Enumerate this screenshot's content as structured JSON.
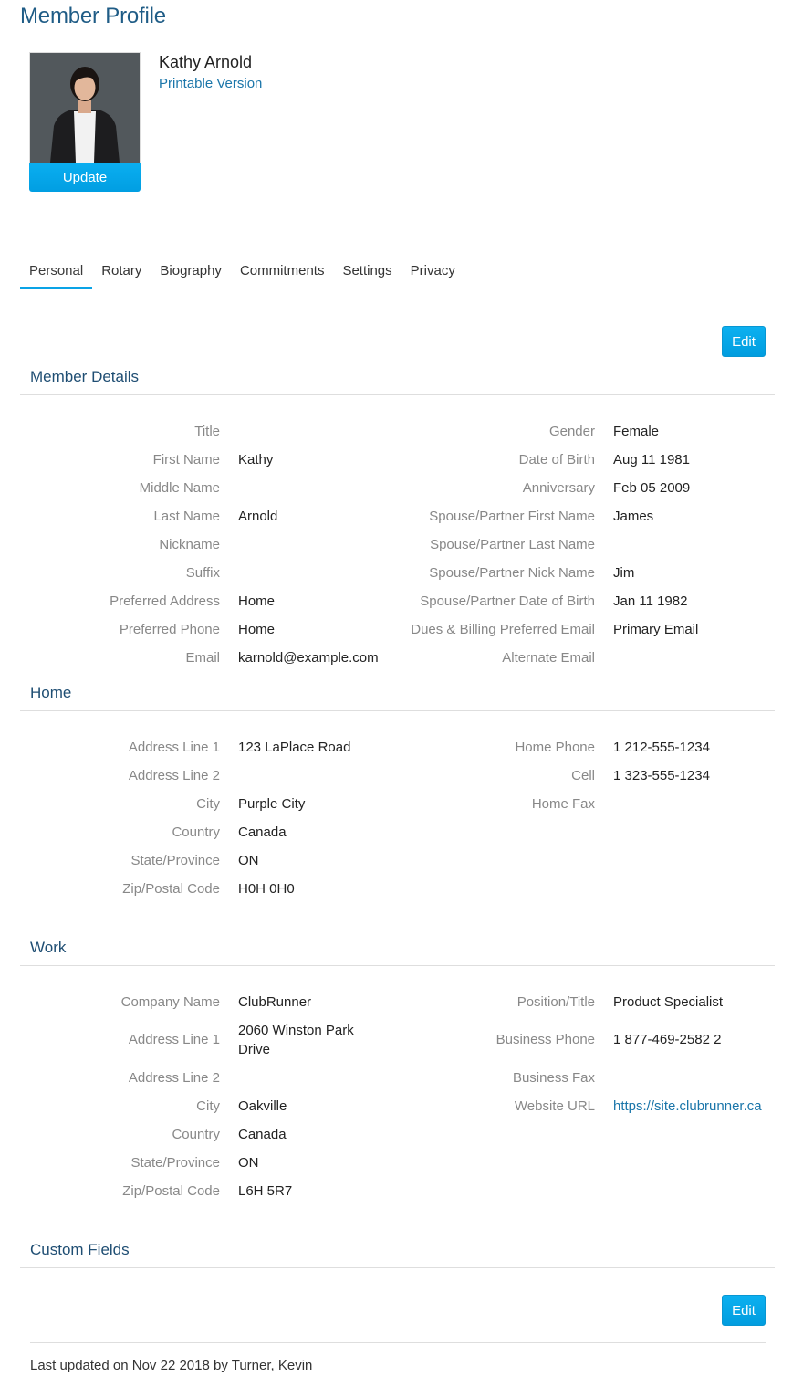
{
  "page": {
    "title": "Member Profile"
  },
  "profile": {
    "name": "Kathy Arnold",
    "printable_link": "Printable Version",
    "update_label": "Update"
  },
  "tabs": [
    {
      "label": "Personal",
      "active": true
    },
    {
      "label": "Rotary",
      "active": false
    },
    {
      "label": "Biography",
      "active": false
    },
    {
      "label": "Commitments",
      "active": false
    },
    {
      "label": "Settings",
      "active": false
    },
    {
      "label": "Privacy",
      "active": false
    }
  ],
  "edit_label": "Edit",
  "member_details": {
    "title": "Member Details",
    "left": [
      {
        "label": "Title",
        "value": ""
      },
      {
        "label": "First Name",
        "value": "Kathy"
      },
      {
        "label": "Middle Name",
        "value": ""
      },
      {
        "label": "Last Name",
        "value": "Arnold"
      },
      {
        "label": "Nickname",
        "value": ""
      },
      {
        "label": "Suffix",
        "value": ""
      },
      {
        "label": "Preferred Address",
        "value": "Home"
      },
      {
        "label": "Preferred Phone",
        "value": "Home"
      },
      {
        "label": "Email",
        "value": "karnold@example.com"
      }
    ],
    "right": [
      {
        "label": "Gender",
        "value": "Female"
      },
      {
        "label": "Date of Birth",
        "value": "Aug 11 1981"
      },
      {
        "label": "Anniversary",
        "value": "Feb 05 2009"
      },
      {
        "label": "Spouse/Partner First Name",
        "value": "James"
      },
      {
        "label": "Spouse/Partner Last Name",
        "value": ""
      },
      {
        "label": "Spouse/Partner Nick Name",
        "value": "Jim"
      },
      {
        "label": "Spouse/Partner Date of Birth",
        "value": "Jan 11 1982"
      },
      {
        "label": "Dues & Billing Preferred Email",
        "value": "Primary Email"
      },
      {
        "label": "Alternate Email",
        "value": ""
      }
    ]
  },
  "home": {
    "title": "Home",
    "left": [
      {
        "label": "Address Line 1",
        "value": "123 LaPlace Road"
      },
      {
        "label": "Address Line 2",
        "value": ""
      },
      {
        "label": "City",
        "value": "Purple City"
      },
      {
        "label": "Country",
        "value": "Canada"
      },
      {
        "label": "State/Province",
        "value": "ON"
      },
      {
        "label": "Zip/Postal Code",
        "value": "H0H 0H0"
      }
    ],
    "right": [
      {
        "label": "Home Phone",
        "value": "1 212-555-1234"
      },
      {
        "label": "Cell",
        "value": "1 323-555-1234"
      },
      {
        "label": "Home Fax",
        "value": ""
      }
    ]
  },
  "work": {
    "title": "Work",
    "left": [
      {
        "label": "Company Name",
        "value": "ClubRunner"
      },
      {
        "label": "Address Line 1",
        "value_line1": "2060 Winston Park",
        "value_line2": "Drive"
      },
      {
        "label": "Address Line 2",
        "value": ""
      },
      {
        "label": "City",
        "value": "Oakville"
      },
      {
        "label": "Country",
        "value": "Canada"
      },
      {
        "label": "State/Province",
        "value": "ON"
      },
      {
        "label": "Zip/Postal Code",
        "value": "L6H 5R7"
      }
    ],
    "right": [
      {
        "label": "Position/Title",
        "value": "Product Specialist"
      },
      {
        "label": "Business Phone",
        "value": "1 877-469-2582 2"
      },
      {
        "label": "Business Fax",
        "value": ""
      },
      {
        "label": "Website URL",
        "value": "https://site.clubrunner.ca"
      }
    ]
  },
  "custom_fields": {
    "title": "Custom Fields"
  },
  "footer": {
    "last_updated": "Last updated on Nov 22 2018 by Turner, Kevin"
  },
  "colors": {
    "accent": "#0aa3e6",
    "heading": "#1f5c86",
    "link": "#1b76aa"
  }
}
